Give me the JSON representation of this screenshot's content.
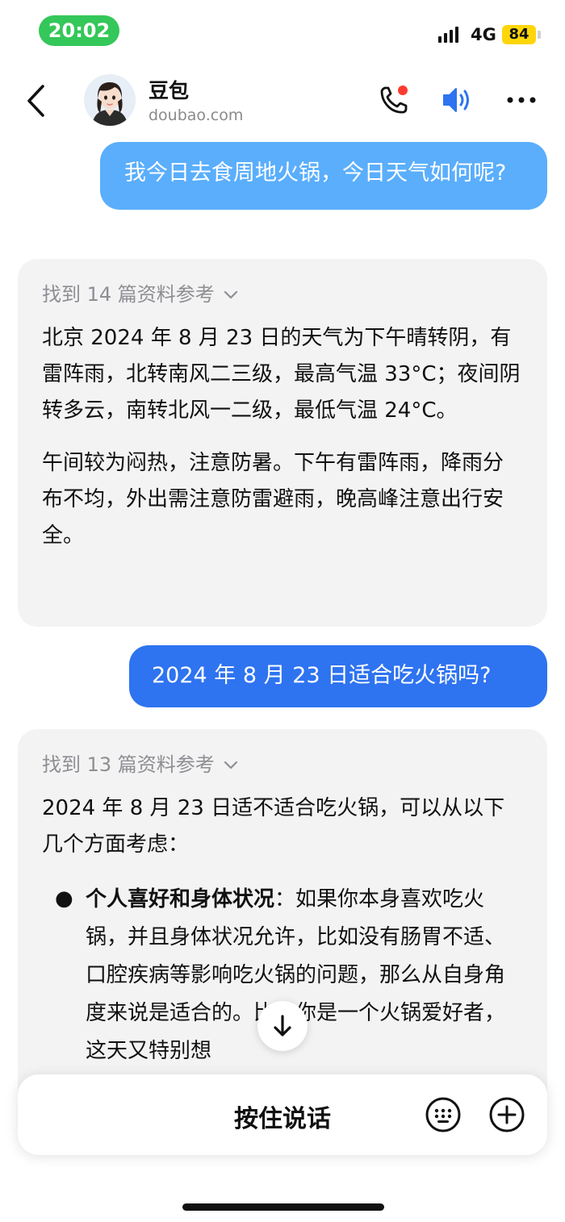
{
  "status_bar": {
    "time": "20:02",
    "network": "4G",
    "battery": "84"
  },
  "header": {
    "name": "豆包",
    "domain": "doubao.com"
  },
  "messages": {
    "user1": "我今日去食周地火锅，今日天气如何呢?",
    "ai1": {
      "refs": "找到 14 篇资料参考",
      "p1": "北京 2024 年 8 月 23 日的天气为下午晴转阴，有雷阵雨，北转南风二三级，最高气温 33°C；夜间阴转多云，南转北风一二级，最低气温 24°C。",
      "p2": "午间较为闷热，注意防暑。下午有雷阵雨，降雨分布不均，外出需注意防雷避雨，晚高峰注意出行安全。"
    },
    "user2": "2024 年 8 月 23 日适合吃火锅吗?",
    "ai2": {
      "refs": "找到 13 篇资料参考",
      "p1": "2024 年 8 月 23 日适不适合吃火锅，可以从以下几个方面考虑：",
      "bullet_title": "个人喜好和身体状况",
      "bullet_text": "：如果你本身喜欢吃火锅，并且身体状况允许，比如没有肠胃不适、口腔疾病等影响吃火锅的问题，那么从自身角度来说是适合的。比如你是一个火锅爱好者，这天又特别想"
    }
  },
  "input_bar": {
    "hold_to_talk": "按住说话"
  },
  "colors": {
    "user_bubble": "#5aaefc",
    "user_bubble_active": "#2e73f0",
    "ai_card": "#f3f3f4",
    "time_pill": "#34c759",
    "battery": "#ffd60a"
  }
}
